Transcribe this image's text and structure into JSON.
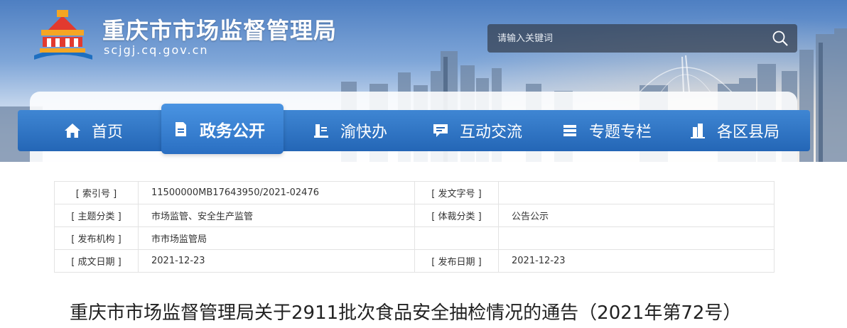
{
  "header": {
    "site_title": "重庆市市场监督管理局",
    "site_domain": "scjgj.cq.gov.cn",
    "search": {
      "placeholder": "请输入关键词"
    }
  },
  "nav": {
    "items": [
      {
        "label": "首页",
        "icon": "home-icon"
      },
      {
        "label": "政务公开",
        "icon": "document-icon",
        "active": true
      },
      {
        "label": "渝快办",
        "icon": "service-icon"
      },
      {
        "label": "互动交流",
        "icon": "chat-icon"
      },
      {
        "label": "专题专栏",
        "icon": "column-icon"
      },
      {
        "label": "各区县局",
        "icon": "building-icon"
      }
    ]
  },
  "meta": {
    "rows": [
      {
        "k1": "[ 索引号 ]",
        "v1": "11500000MB17643950/2021-02476",
        "k2": "[ 发文字号 ]",
        "v2": ""
      },
      {
        "k1": "[ 主题分类 ]",
        "v1": "市场监管、安全生产监管",
        "k2": "[ 体裁分类 ]",
        "v2": "公告公示"
      },
      {
        "k1": "[ 发布机构 ]",
        "v1": "市市场监管局",
        "k2": "",
        "v2": ""
      },
      {
        "k1": "[ 成文日期 ]",
        "v1": "2021-12-23",
        "k2": "[ 发布日期 ]",
        "v2": "2021-12-23"
      }
    ]
  },
  "article": {
    "title": "重庆市市场监督管理局关于2911批次食品安全抽检情况的通告（2021年第72号）"
  },
  "colors": {
    "nav_blue": "#2466b6",
    "nav_active": "#3f86d3",
    "logo_red": "#e23a2f",
    "logo_orange": "#f5a623",
    "logo_blue": "#1e6fc0"
  }
}
